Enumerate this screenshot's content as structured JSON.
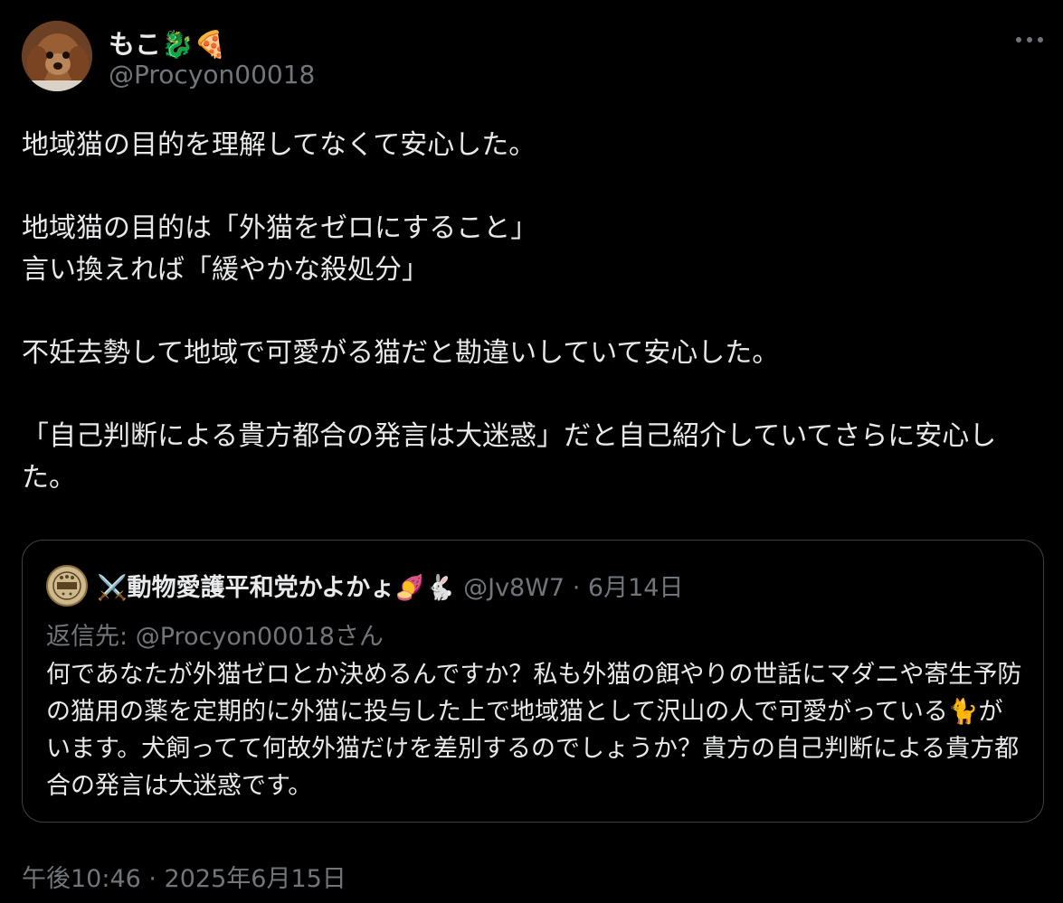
{
  "author": {
    "display_name": "もこ🐉🍕",
    "handle": "@Procyon00018",
    "avatar_icon": "dog-photo-avatar-icon"
  },
  "more_icon": "more-horizontal-icon",
  "body_text": "地域猫の目的を理解してなくて安心した。\n\n地域猫の目的は「外猫をゼロにすること」\n言い換えれば「緩やかな殺処分」\n\n不妊去勢して地域で可愛がる猫だと勘違いしていて安心した。\n\n「自己判断による貴方都合の発言は大迷惑」だと自己紹介していてさらに安心した。",
  "quote": {
    "avatar_icon": "sos-animals-avatar-icon",
    "display_name": "⚔️動物愛護平和党かよかょ🍠🐇",
    "handle": "@Jv8W7",
    "separator": "·",
    "date": "6月14日",
    "reply_label": "返信先:",
    "reply_handle": "@Procyon00018さん",
    "text": "何であなたが外猫ゼロとか決めるんですか？私も外猫の餌やりの世話にマダニや寄生予防の猫用の薬を定期的に外猫に投与した上で地域猫として沢山の人で可愛がっている🐈がいます。犬飼ってて何故外猫だけを差別するのでしょうか？貴方の自己判断による貴方都合の発言は大迷惑です。"
  },
  "timestamp": "午後10:46 · 2025年6月15日",
  "colors": {
    "background": "#000000",
    "text_primary": "#e7e9ea",
    "text_secondary": "#71767b",
    "border": "#3e4144"
  }
}
